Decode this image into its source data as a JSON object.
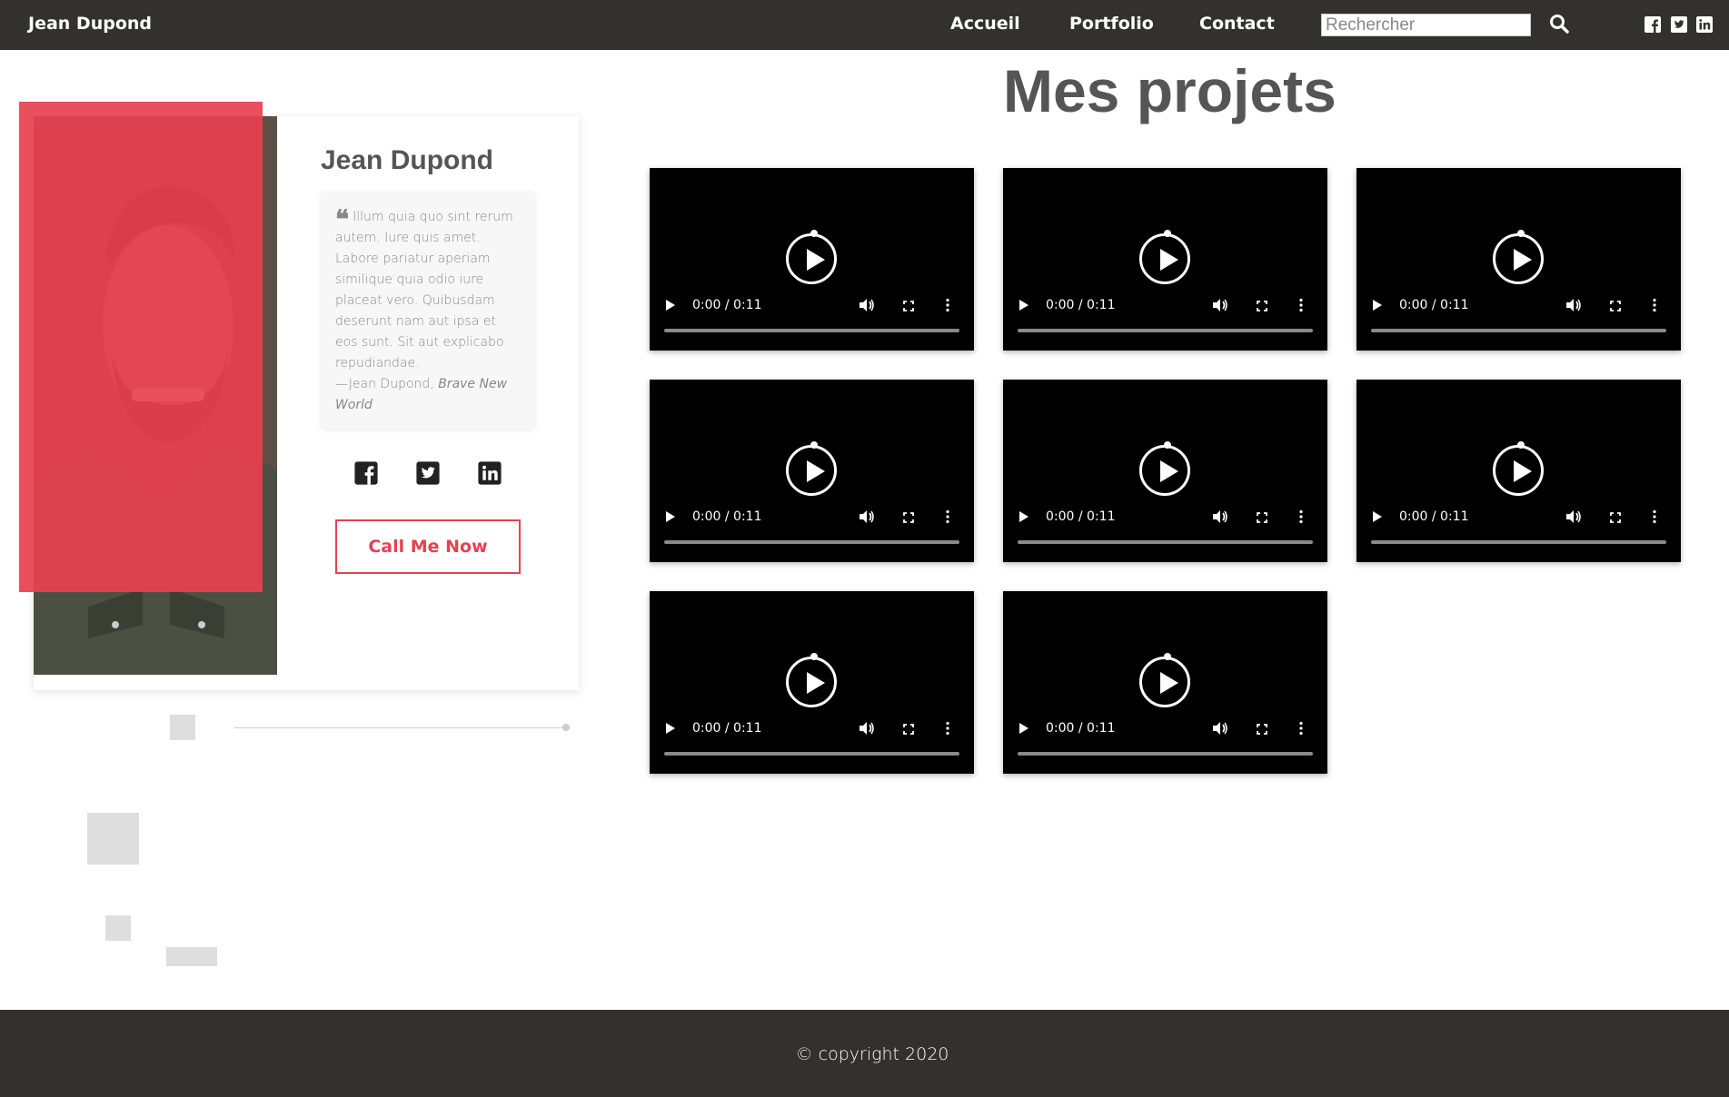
{
  "navbar": {
    "brand": "Jean Dupond",
    "links": [
      "Accueil",
      "Portfolio",
      "Contact"
    ],
    "search_placeholder": "Rechercher",
    "social_icons": [
      "facebook-icon",
      "twitter-icon",
      "linkedin-icon"
    ]
  },
  "profile": {
    "name": "Jean Dupond",
    "quote": "Illum quia quo sint rerum autem. Iure quis amet. Labore pariatur aperiam similique quia odio iure placeat vero. Quibusdam deserunt nam aut ipsa et eos sunt. Sit aut explicabo repudiandae.",
    "quote_author": "—Jean Dupond, ",
    "quote_source": "Brave New World",
    "social_icons": [
      "facebook-icon",
      "twitter-icon",
      "linkedin-icon"
    ],
    "cta": "Call Me Now",
    "accent_color": "#e84050"
  },
  "projects": {
    "title": "Mes projets",
    "videos": [
      {
        "time": "0:00 / 0:11"
      },
      {
        "time": "0:00 / 0:11"
      },
      {
        "time": "0:00 / 0:11"
      },
      {
        "time": "0:00 / 0:11"
      },
      {
        "time": "0:00 / 0:11"
      },
      {
        "time": "0:00 / 0:11"
      },
      {
        "time": "0:00 / 0:11"
      },
      {
        "time": "0:00 / 0:11"
      }
    ]
  },
  "footer": {
    "copyright": "© copyright 2020"
  }
}
